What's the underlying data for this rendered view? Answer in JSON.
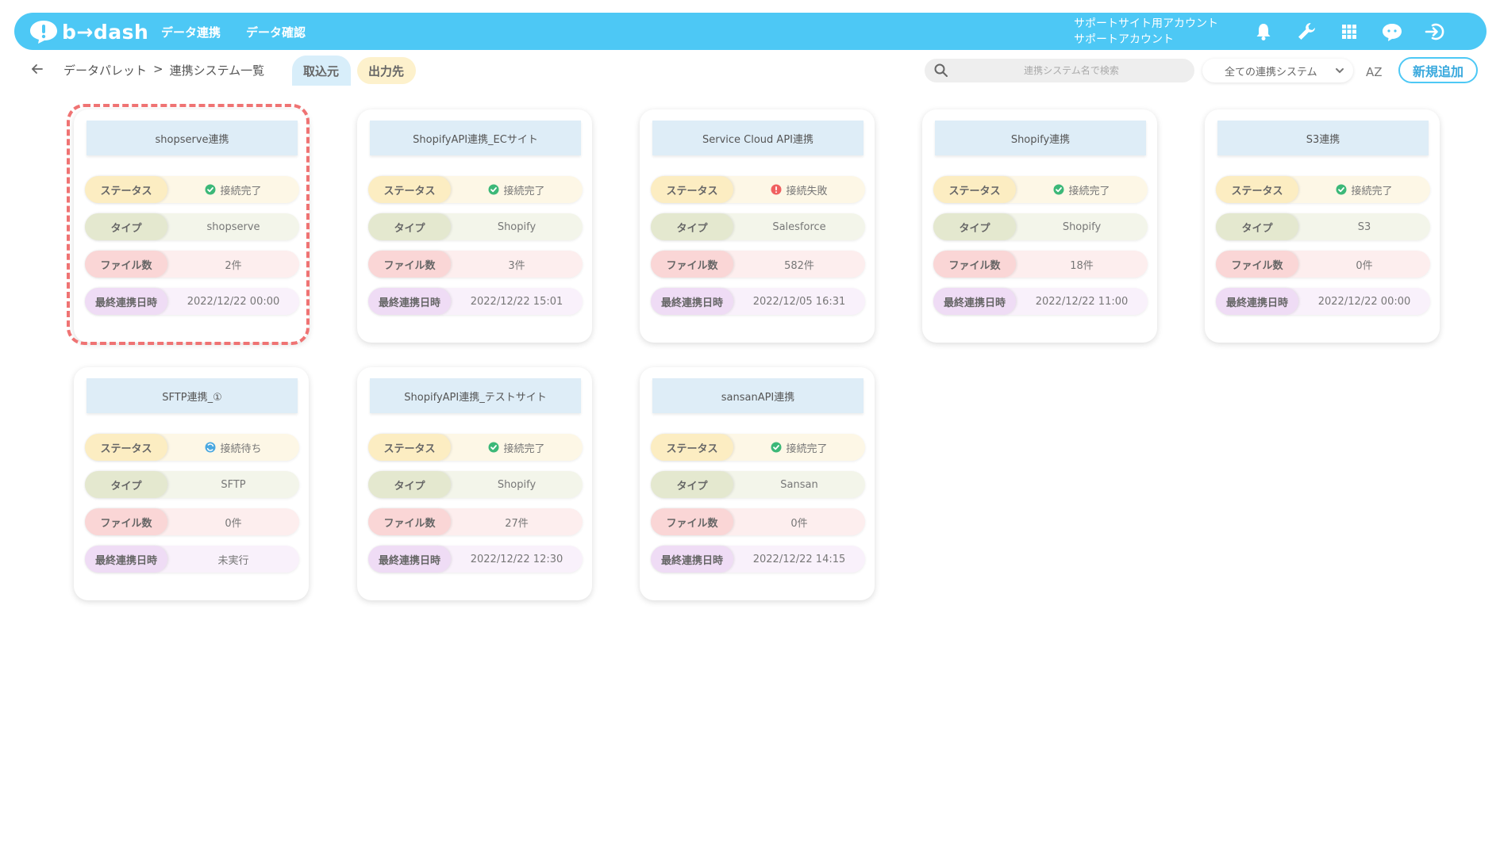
{
  "brand": {
    "logo_text": "b→dash"
  },
  "nav": {
    "items": [
      "データ連携",
      "データ確認"
    ]
  },
  "account": {
    "line1": "サポートサイト用アカウント",
    "line2": "サポートアカウント"
  },
  "topbar_icons": [
    "bell-icon",
    "wrench-icon",
    "grid-icon",
    "chat-bot-icon",
    "logout-icon"
  ],
  "breadcrumb": {
    "root": "データパレット",
    "separator": ">",
    "current": "連携システム一覧"
  },
  "tabs": {
    "import": "取込元",
    "export": "出力先"
  },
  "search": {
    "placeholder": "連携システム名で検索",
    "value": ""
  },
  "filter": {
    "selected": "全ての連携システム"
  },
  "sort": {
    "label": "AZ"
  },
  "new_button": "新規追加",
  "labels": {
    "status": "ステータス",
    "type": "タイプ",
    "files": "ファイル数",
    "last": "最終連携日時"
  },
  "colors": {
    "accent": "#4dc8f5",
    "ok": "#3cb878",
    "error": "#f06060",
    "waiting": "#4aa8e0",
    "highlight": "#ef7373"
  },
  "cards": [
    {
      "title": "shopserve連携",
      "status": "接続完了",
      "status_kind": "ok",
      "type": "shopserve",
      "files": "2件",
      "last": "2022/12/22 00:00",
      "highlighted": true
    },
    {
      "title": "ShopifyAPI連携_ECサイト",
      "status": "接続完了",
      "status_kind": "ok",
      "type": "Shopify",
      "files": "3件",
      "last": "2022/12/22 15:01"
    },
    {
      "title": "Service Cloud API連携",
      "status": "接続失敗",
      "status_kind": "error",
      "type": "Salesforce",
      "files": "582件",
      "last": "2022/12/05 16:31"
    },
    {
      "title": "Shopify連携",
      "status": "接続完了",
      "status_kind": "ok",
      "type": "Shopify",
      "files": "18件",
      "last": "2022/12/22 11:00"
    },
    {
      "title": "S3連携",
      "status": "接続完了",
      "status_kind": "ok",
      "type": "S3",
      "files": "0件",
      "last": "2022/12/22 00:00"
    },
    {
      "title": "SFTP連携_①",
      "status": "接続待ち",
      "status_kind": "waiting",
      "type": "SFTP",
      "files": "0件",
      "last": "未実行"
    },
    {
      "title": "ShopifyAPI連携_テストサイト",
      "status": "接続完了",
      "status_kind": "ok",
      "type": "Shopify",
      "files": "27件",
      "last": "2022/12/22 12:30"
    },
    {
      "title": "sansanAPI連携",
      "status": "接続完了",
      "status_kind": "ok",
      "type": "Sansan",
      "files": "0件",
      "last": "2022/12/22 14:15"
    }
  ]
}
